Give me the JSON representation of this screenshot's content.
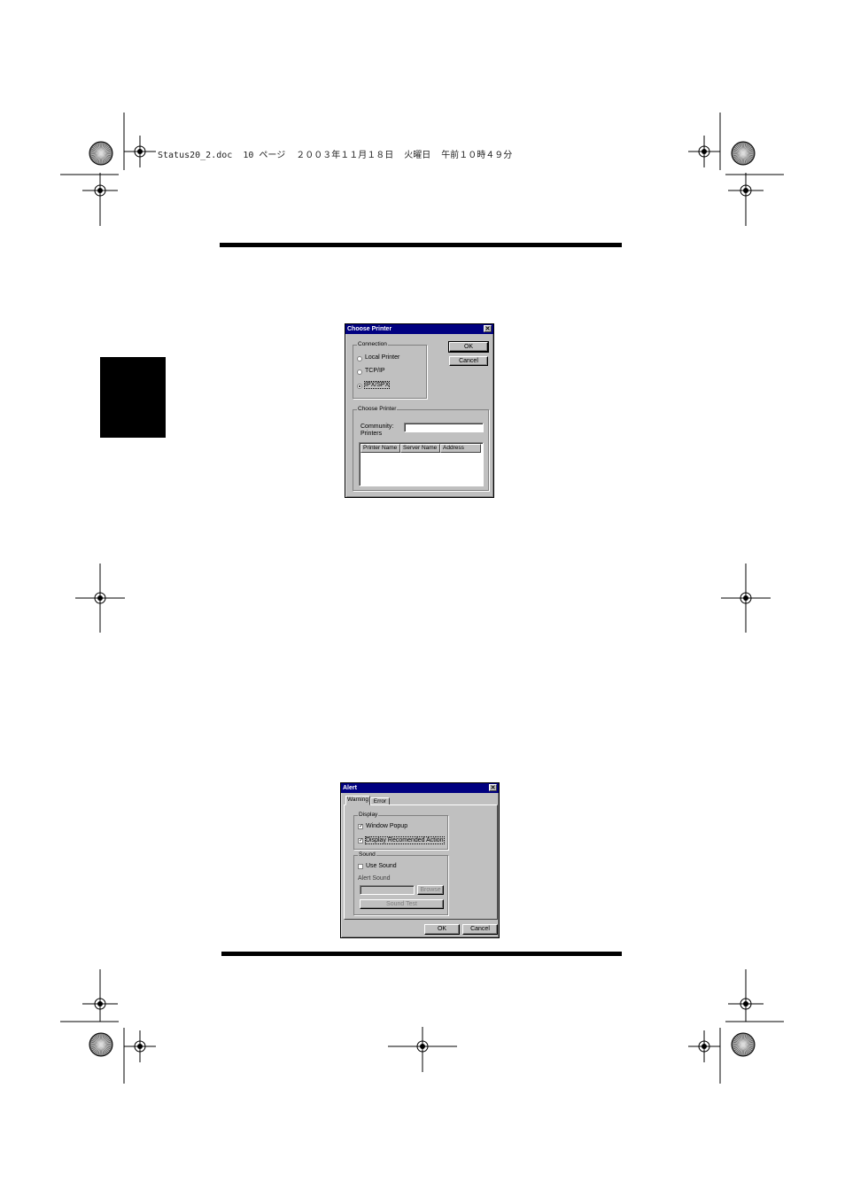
{
  "header": {
    "file_info": "Status20_2.doc  10 ページ  ２００３年１１月１８日  火曜日  午前１０時４９分"
  },
  "choose_printer_dialog": {
    "title": "Choose Printer",
    "connection_group": "Connection",
    "options": [
      {
        "label": "Local Printer",
        "selected": false
      },
      {
        "label": "TCP/IP",
        "selected": false
      },
      {
        "label": "IPX/SPX",
        "selected": true
      }
    ],
    "ok_label": "OK",
    "cancel_label": "Cancel",
    "choose_group": "Choose Printer",
    "community_label": "Community:",
    "printers_label": "Printers",
    "community_value": "",
    "columns": [
      "Printer Name",
      "Server Name",
      "Address"
    ]
  },
  "alert_dialog": {
    "title": "Alert",
    "tabs": [
      {
        "label": "Warning",
        "active": true
      },
      {
        "label": "Error",
        "active": false
      }
    ],
    "display_group": "Display",
    "window_popup_label": "Window Popup",
    "window_popup_checked": true,
    "recommended_action_label": "Display Recomended Action",
    "recommended_action_checked": true,
    "sound_group": "Sound",
    "use_sound_label": "Use Sound",
    "use_sound_checked": false,
    "alert_sound_label": "Alert Sound",
    "browse_label": "Browse",
    "sound_test_label": "Sound Test",
    "ok_label": "OK",
    "cancel_label": "Cancel"
  }
}
